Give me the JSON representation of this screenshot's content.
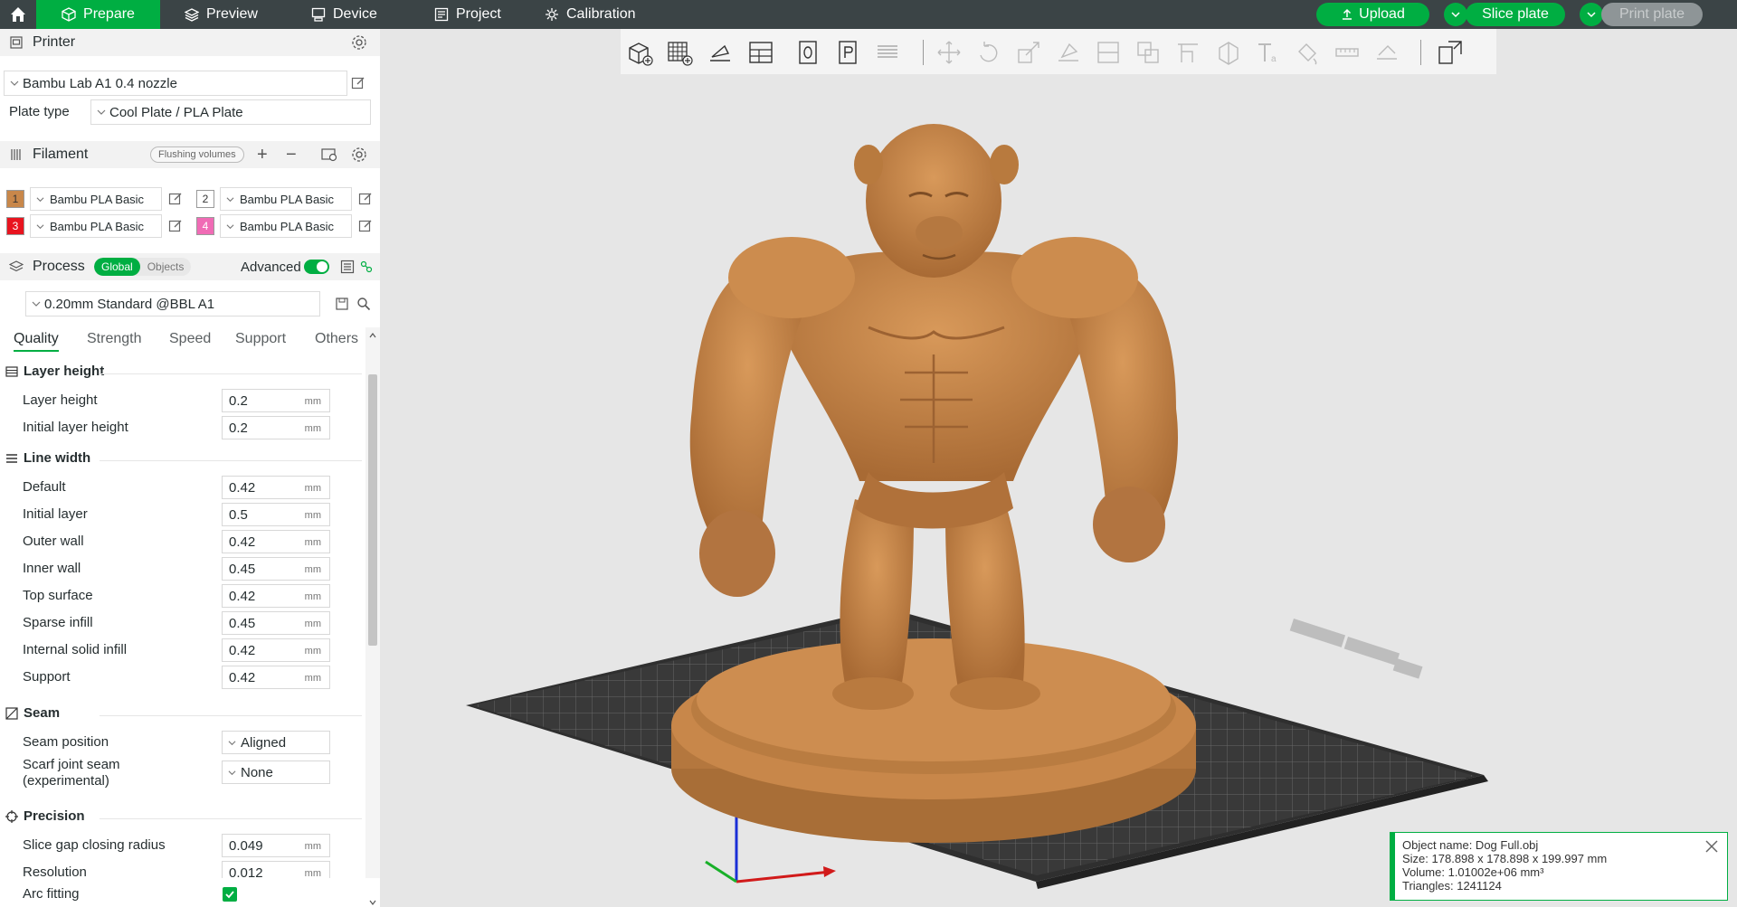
{
  "topbar": {
    "tabs": [
      {
        "label": "Prepare",
        "icon": "cube-icon"
      },
      {
        "label": "Preview",
        "icon": "layers-icon"
      },
      {
        "label": "Device",
        "icon": "device-icon"
      },
      {
        "label": "Project",
        "icon": "project-icon"
      },
      {
        "label": "Calibration",
        "icon": "calibration-icon"
      }
    ],
    "upload_label": "Upload",
    "slice_label": "Slice plate",
    "print_label": "Print plate"
  },
  "printer": {
    "section_title": "Printer",
    "printer_name": "Bambu Lab A1 0.4 nozzle",
    "plate_type_label": "Plate type",
    "plate_type_value": "Cool Plate / PLA Plate"
  },
  "filament": {
    "section_title": "Filament",
    "flushing_label": "Flushing volumes",
    "slots": [
      {
        "num": "1",
        "name": "Bambu PLA Basic",
        "color": "#c8874a"
      },
      {
        "num": "2",
        "name": "Bambu PLA Basic",
        "color": "#ffffff"
      },
      {
        "num": "3",
        "name": "Bambu PLA Basic",
        "color": "#e8141f"
      },
      {
        "num": "4",
        "name": "Bambu PLA Basic",
        "color": "#f06bb5"
      }
    ]
  },
  "process": {
    "section_title": "Process",
    "global_label": "Global",
    "objects_label": "Objects",
    "advanced_label": "Advanced",
    "profile": "0.20mm Standard @BBL A1",
    "tabs": [
      "Quality",
      "Strength",
      "Speed",
      "Support",
      "Others"
    ],
    "layer_height_group": {
      "title": "Layer height",
      "rows": [
        {
          "label": "Layer height",
          "value": "0.2",
          "unit": "mm"
        },
        {
          "label": "Initial layer height",
          "value": "0.2",
          "unit": "mm"
        }
      ]
    },
    "line_width_group": {
      "title": "Line width",
      "rows": [
        {
          "label": "Default",
          "value": "0.42",
          "unit": "mm"
        },
        {
          "label": "Initial layer",
          "value": "0.5",
          "unit": "mm"
        },
        {
          "label": "Outer wall",
          "value": "0.42",
          "unit": "mm"
        },
        {
          "label": "Inner wall",
          "value": "0.45",
          "unit": "mm"
        },
        {
          "label": "Top surface",
          "value": "0.42",
          "unit": "mm"
        },
        {
          "label": "Sparse infill",
          "value": "0.45",
          "unit": "mm"
        },
        {
          "label": "Internal solid infill",
          "value": "0.42",
          "unit": "mm"
        },
        {
          "label": "Support",
          "value": "0.42",
          "unit": "mm"
        }
      ]
    },
    "seam_group": {
      "title": "Seam",
      "seam_position_label": "Seam position",
      "seam_position_value": "Aligned",
      "scarf_label_1": "Scarf joint seam",
      "scarf_label_2": "(experimental)",
      "scarf_value": "None"
    },
    "precision_group": {
      "title": "Precision",
      "rows": [
        {
          "label": "Slice gap closing radius",
          "value": "0.049",
          "unit": "mm"
        },
        {
          "label": "Resolution",
          "value": "0.012",
          "unit": "mm"
        }
      ],
      "arc_fitting_label": "Arc fitting",
      "arc_fitting_checked": true
    }
  },
  "object_info": {
    "name_line": "Object name: Dog Full.obj",
    "size_line": "Size: 178.898 x 178.898 x 199.997 mm",
    "volume_line": "Volume: 1.01002e+06 mm³",
    "triangles_line": "Triangles: 1241124"
  },
  "colors": {
    "accent": "#00ae42",
    "topbar_bg": "#3b4446",
    "model": "#c8874a",
    "canvas_bg": "#e6e6e6"
  }
}
